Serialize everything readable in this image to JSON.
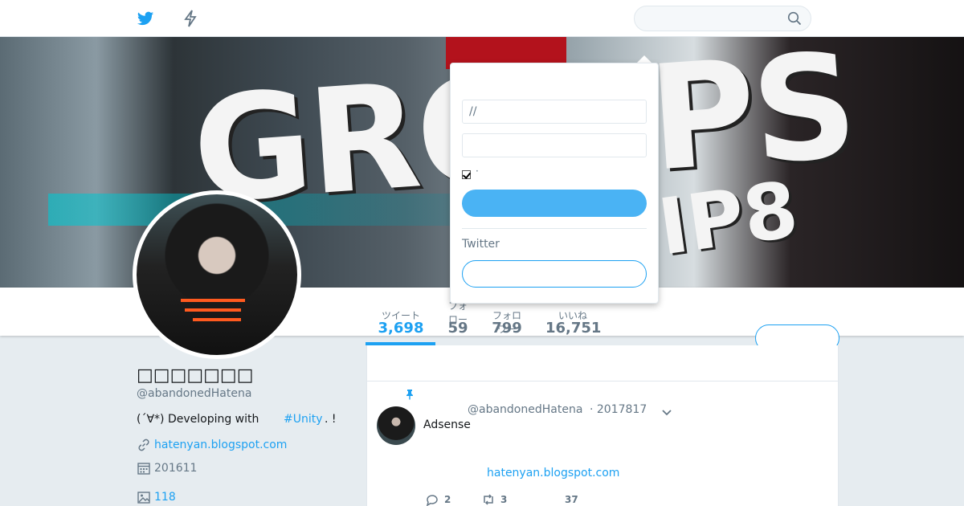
{
  "header": {
    "search_placeholder": "",
    "icons": [
      "twitter-bird-icon",
      "moments-bolt-icon",
      "search-icon"
    ]
  },
  "banner": {
    "text_main": "GROUPS",
    "text_sub": "IP8"
  },
  "stats": [
    {
      "label": "ツイート",
      "value": "3,698"
    },
    {
      "label": "フォロー",
      "value": "59"
    },
    {
      "label": "フォロワー",
      "value": "799"
    },
    {
      "label": "いいね",
      "value": "16,751"
    }
  ],
  "profile": {
    "name": "□□□□□□□",
    "handle": "@abandonedHatena",
    "bio": "(´∀*) Developing with",
    "bio_tag": "#Unity",
    "bio_end": ". !",
    "website": "hatenyan.blogspot.com",
    "joined": "201611",
    "media_count": "118"
  },
  "tweet": {
    "handle": "@abandonedHatena",
    "date": "· 2017817",
    "text": "Adsense",
    "link": "hatenyan.blogspot.com",
    "replies": "2",
    "retweets": "3",
    "likes": "37"
  },
  "login": {
    "username_value": "//",
    "password_value": "",
    "remember_label": "·",
    "twitter_label": "Twitter"
  },
  "colors": {
    "accent": "#1da1f2",
    "login_button": "#4ab3f4",
    "background": "#e6ecf0"
  }
}
